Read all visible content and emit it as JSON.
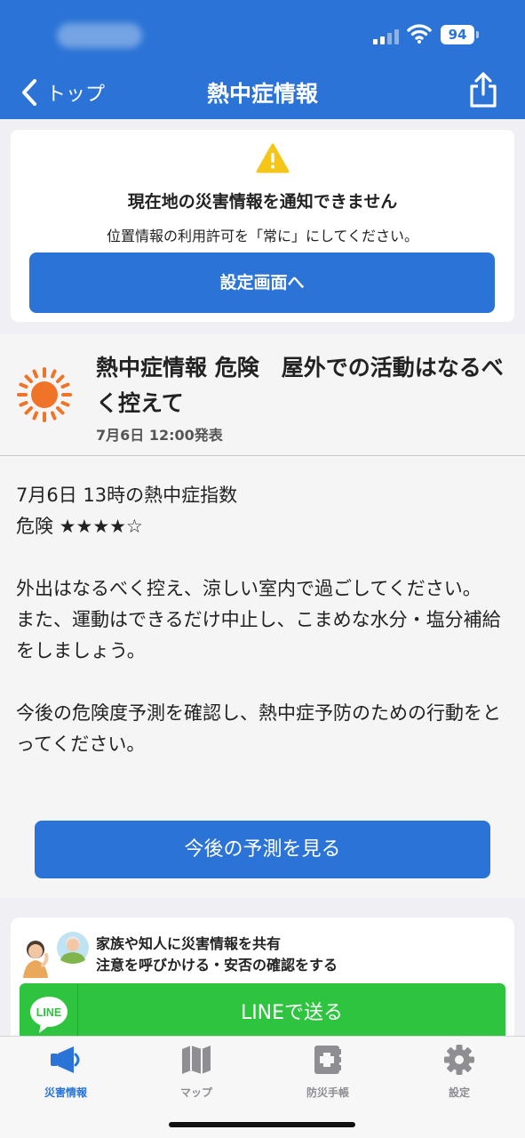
{
  "status_bar": {
    "battery": "94"
  },
  "header": {
    "back_label": "トップ",
    "title": "熱中症情報",
    "back_icon": "chevron-left-icon",
    "share_icon": "share-icon",
    "color": "#2b73d6"
  },
  "location_notice": {
    "icon": "warning-icon",
    "title": "現在地の災害情報を通知できません",
    "message": "位置情報の利用許可を「常に」にしてください。",
    "button_label": "設定画面へ"
  },
  "heat_info": {
    "icon": "sun-icon",
    "headline": "熱中症情報 危険　屋外での活動はなるべく控えて",
    "issued": "7月6日 12:00発表",
    "index_title": "7月6日 13時の熱中症指数",
    "level": "危険 ★★★★☆",
    "level_stars": 4,
    "level_max": 5,
    "advice_1": "外出はなるべく控え、涼しい室内で過ごしてください。",
    "advice_2": "また、運動はできるだけ中止し、こまめな水分・塩分補給をしましょう。",
    "advice_3": "今後の危険度予測を確認し、熱中症予防のための行動をとってください。",
    "forecast_button": "今後の予測を見る"
  },
  "share": {
    "title": "家族や知人に災害情報を共有",
    "subtitle": "注意を呼びかける・安否の確認をする",
    "line_logo_text": "LINE",
    "line_button": "LINEで送る",
    "line_color": "#2fc43f"
  },
  "tabbar": {
    "tabs": [
      {
        "label": "災害情報",
        "icon": "megaphone-icon",
        "active": true
      },
      {
        "label": "マップ",
        "icon": "map-icon",
        "active": false
      },
      {
        "label": "防災手帳",
        "icon": "first-aid-book-icon",
        "active": false
      },
      {
        "label": "設定",
        "icon": "gear-icon",
        "active": false
      }
    ]
  }
}
